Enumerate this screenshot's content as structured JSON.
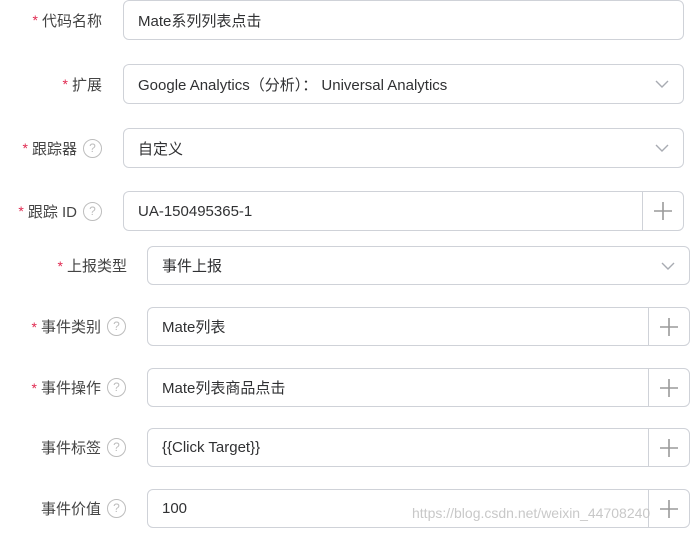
{
  "form": {
    "code_name": {
      "required": "*",
      "label": "代码名称",
      "value": "Mate系列列表点击"
    },
    "extension": {
      "required": "*",
      "label": "扩展",
      "value": "Google Analytics（分析）： Universal Analytics"
    },
    "tracker": {
      "required": "*",
      "label": "跟踪器",
      "help": "?",
      "value": "自定义"
    },
    "tracker_id": {
      "required": "*",
      "label": "跟踪 ID",
      "help": "?",
      "value": "UA-150495365-1"
    },
    "report_type": {
      "required": "*",
      "label": "上报类型",
      "value": "事件上报"
    },
    "event_category": {
      "required": "*",
      "label": "事件类别",
      "help": "?",
      "value": "Mate列表"
    },
    "event_action": {
      "required": "*",
      "label": "事件操作",
      "help": "?",
      "value": "Mate列表商品点击"
    },
    "event_label": {
      "label": "事件标签",
      "help": "?",
      "value": "{{Click Target}}"
    },
    "event_value": {
      "label": "事件价值",
      "help": "?",
      "value": "100"
    }
  },
  "icons": {
    "select_arrow": "chevron-down-icon",
    "add_variable": "plus-icon",
    "help": "question-circle-icon"
  },
  "watermark": "https://blog.csdn.net/weixin_44708240",
  "colors": {
    "required_mark": "#e0284f",
    "border": "#cfd2d8",
    "help_icon": "#bdbdbd"
  }
}
